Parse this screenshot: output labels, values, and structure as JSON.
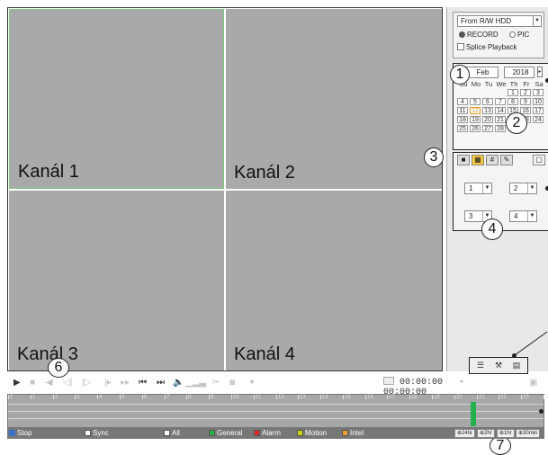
{
  "panes": [
    {
      "label": "Kanál 1"
    },
    {
      "label": "Kanál 2"
    },
    {
      "label": "Kanál 3"
    },
    {
      "label": "Kanál 4"
    }
  ],
  "source": {
    "selected": "From R/W HDD",
    "record_label": "RECORD",
    "pic_label": "PIC",
    "record_selected": true,
    "splice_label": "Splice Playback"
  },
  "calendar": {
    "month": "Feb",
    "year": "2018",
    "weekdays": [
      "Su",
      "Mo",
      "Tu",
      "We",
      "Th",
      "Fr",
      "Sa"
    ],
    "weeks": [
      [
        "",
        "",
        "",
        "",
        "1",
        "2",
        "3"
      ],
      [
        "4",
        "5",
        "6",
        "7",
        "8",
        "9",
        "10"
      ],
      [
        "11",
        "12",
        "13",
        "14",
        "15",
        "16",
        "17"
      ],
      [
        "18",
        "19",
        "20",
        "21",
        "22",
        "23",
        "24"
      ],
      [
        "25",
        "26",
        "27",
        "28",
        "",
        "",
        ""
      ]
    ],
    "highlighted_day": "12"
  },
  "split": {
    "channel_selects": [
      "1",
      "2",
      "3",
      "4"
    ]
  },
  "callouts": [
    "1",
    "2",
    "3",
    "4",
    "5",
    "6",
    "7"
  ],
  "playback": {
    "time_start": "00:00:00",
    "time_end": "- 00:00:00"
  },
  "timeline": {
    "hours": [
      "0",
      "1",
      "2",
      "3",
      "4",
      "5",
      "6",
      "7",
      "8",
      "9",
      "10",
      "11",
      "12",
      "13",
      "14",
      "15",
      "16",
      "17",
      "18",
      "19",
      "20",
      "21",
      "22",
      "23",
      "24"
    ]
  },
  "legend": {
    "stop": "Stop",
    "sync": "Sync",
    "all": "All",
    "general": "General",
    "alarm": "Alarm",
    "motion": "Motion",
    "intel": "Intel",
    "colors": {
      "general": "#22b14c",
      "alarm": "#e02a2a",
      "motion": "#c8d400",
      "intel": "#f0a030"
    },
    "zoom": [
      "24hr",
      "2hr",
      "1hr",
      "30min"
    ]
  }
}
